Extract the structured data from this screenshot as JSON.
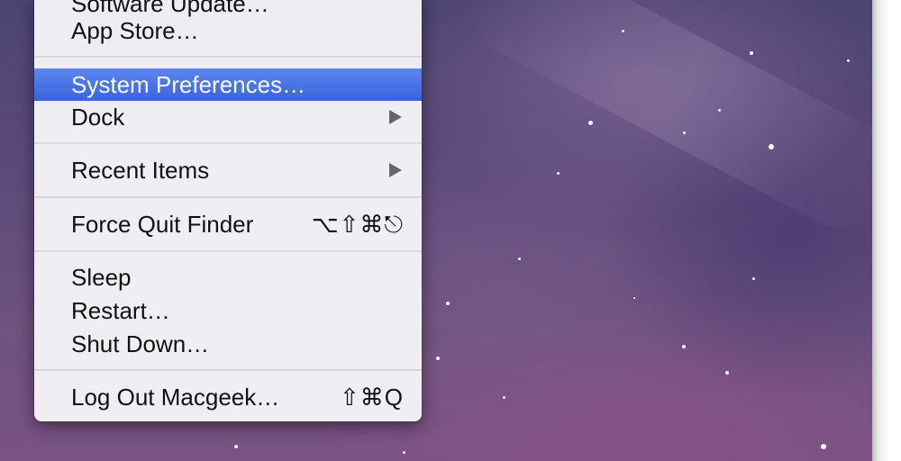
{
  "menu": {
    "software_update": "Software Update…",
    "app_store": "App Store…",
    "system_preferences": "System Preferences…",
    "dock": "Dock",
    "recent_items": "Recent Items",
    "force_quit": "Force Quit Finder",
    "force_quit_shortcut": "⌥⇧⌘⎋",
    "sleep": "Sleep",
    "restart": "Restart…",
    "shut_down": "Shut Down…",
    "log_out": "Log Out Macgeek…",
    "log_out_shortcut": "⇧⌘Q"
  },
  "colors": {
    "highlight": "#3f6ae0",
    "menu_bg": "#f4f4f6"
  }
}
